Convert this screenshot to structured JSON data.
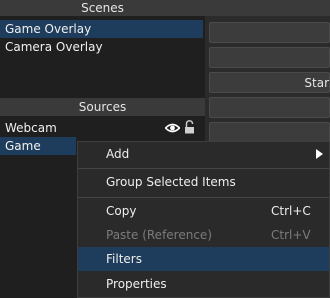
{
  "scenes": {
    "header": "Scenes",
    "items": [
      {
        "label": "Game Overlay",
        "selected": true
      },
      {
        "label": "Camera Overlay",
        "selected": false
      }
    ]
  },
  "sources": {
    "header": "Sources",
    "items": [
      {
        "label": "Webcam",
        "selected": false
      },
      {
        "label": "Game",
        "selected": true
      }
    ]
  },
  "right_panel": {
    "start_label": "Star"
  },
  "context_menu": {
    "items": [
      {
        "label": "Add",
        "shortcut": "",
        "enabled": true,
        "has_submenu": true
      },
      {
        "label": "Group Selected Items",
        "shortcut": "",
        "enabled": true
      },
      {
        "label": "Copy",
        "shortcut": "Ctrl+C",
        "enabled": true
      },
      {
        "label": "Paste (Reference)",
        "shortcut": "Ctrl+V",
        "enabled": false
      },
      {
        "label": "Filters",
        "shortcut": "",
        "enabled": true,
        "highlighted": true
      },
      {
        "label": "Properties",
        "shortcut": "",
        "enabled": true
      }
    ]
  },
  "colors": {
    "selection": "#1e3d5c",
    "panel_bg": "#1f1f1f",
    "header_bg": "#3a3a3a",
    "disabled_text": "#7b7b7b"
  },
  "icons": [
    "eye-icon",
    "lock-icon",
    "chevron-right-icon"
  ]
}
